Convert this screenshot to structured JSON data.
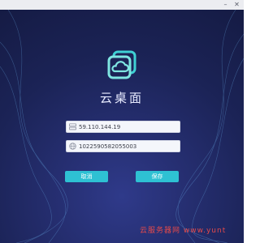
{
  "app": {
    "title": "云桌面"
  },
  "window": {
    "minimize_glyph": "–",
    "close_glyph": "✕"
  },
  "form": {
    "server_address": {
      "value": "59.110.144.19",
      "icon": "server-icon"
    },
    "device_id": {
      "value": "1022590582055003",
      "icon": "globe-icon"
    }
  },
  "buttons": {
    "cancel": "取消",
    "save": "保存"
  },
  "watermark": "云服务器网 www.yunt",
  "colors": {
    "accent": "#2ec1d3",
    "background": "#1b2356",
    "logo_teal": "#3fd1d4"
  }
}
